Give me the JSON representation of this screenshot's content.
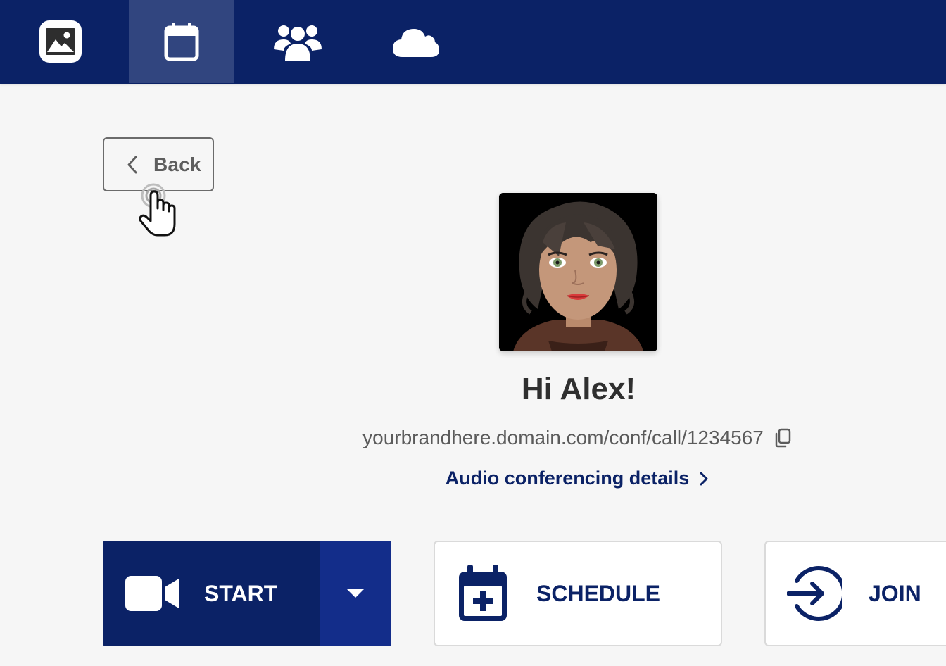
{
  "nav": {
    "items": [
      {
        "icon": "image-icon",
        "active": false
      },
      {
        "icon": "calendar-icon",
        "active": true
      },
      {
        "icon": "users-icon",
        "active": false
      },
      {
        "icon": "cloud-icon",
        "active": false
      }
    ]
  },
  "back": {
    "label": "Back"
  },
  "profile": {
    "greeting": "Hi Alex!",
    "meeting_link": "yourbrandhere.domain.com/conf/call/1234567",
    "audio_details_label": "Audio conferencing details"
  },
  "actions": {
    "start_label": "START",
    "schedule_label": "SCHEDULE",
    "join_label": "JOIN"
  },
  "colors": {
    "brand": "#0b2266",
    "brand_accent": "#132d8a",
    "background": "#f6f6f6"
  }
}
